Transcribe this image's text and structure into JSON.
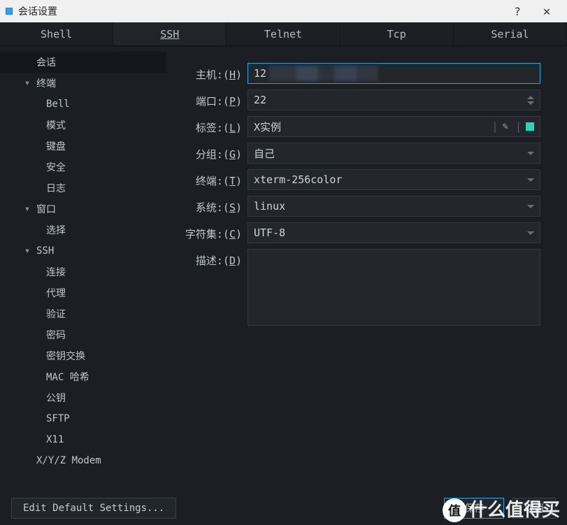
{
  "window": {
    "title": "会话设置",
    "help": "?",
    "close": "✕"
  },
  "top_tabs": [
    {
      "label": "Shell",
      "active": false
    },
    {
      "label": "SSH",
      "active": true
    },
    {
      "label": "Telnet",
      "active": false
    },
    {
      "label": "Tcp",
      "active": false
    },
    {
      "label": "Serial",
      "active": false
    }
  ],
  "tree": [
    {
      "label": "会话",
      "level": 1,
      "caret": "",
      "selected": true
    },
    {
      "label": "终端",
      "level": 1,
      "caret": "▾"
    },
    {
      "label": "Bell",
      "level": 2
    },
    {
      "label": "模式",
      "level": 2
    },
    {
      "label": "键盘",
      "level": 2
    },
    {
      "label": "安全",
      "level": 2
    },
    {
      "label": "日志",
      "level": 2
    },
    {
      "label": "窗口",
      "level": 1,
      "caret": "▾"
    },
    {
      "label": "选择",
      "level": 2
    },
    {
      "label": "SSH",
      "level": 1,
      "caret": "▾"
    },
    {
      "label": "连接",
      "level": 2
    },
    {
      "label": "代理",
      "level": 2
    },
    {
      "label": "验证",
      "level": 2
    },
    {
      "label": "密码",
      "level": 2
    },
    {
      "label": "密钥交换",
      "level": 2
    },
    {
      "label": "MAC 哈希",
      "level": 2
    },
    {
      "label": "公钥",
      "level": 2
    },
    {
      "label": "SFTP",
      "level": 2
    },
    {
      "label": "X11",
      "level": 2
    },
    {
      "label": "X/Y/Z Modem",
      "level": 1,
      "caret": ""
    }
  ],
  "form": {
    "host_label": "主机:",
    "host_accel": "H",
    "host_value": "12",
    "port_label": "端口:",
    "port_accel": "P",
    "port_value": "22",
    "tag_label": "标签:",
    "tag_accel": "L",
    "tag_value": "X实例",
    "group_label": "分组:",
    "group_accel": "G",
    "group_value": "自己",
    "term_label": "终端:",
    "term_accel": "T",
    "term_value": "xterm-256color",
    "os_label": "系统:",
    "os_accel": "S",
    "os_value": "linux",
    "charset_label": "字符集:",
    "charset_accel": "C",
    "charset_value": "UTF-8",
    "desc_label": "描述:",
    "desc_accel": "D",
    "desc_value": ""
  },
  "bottom": {
    "edit_default": "Edit Default Settings...",
    "save": "保存",
    "cancel": "取消"
  },
  "watermark": {
    "badge": "值",
    "text": "什么值得买"
  }
}
